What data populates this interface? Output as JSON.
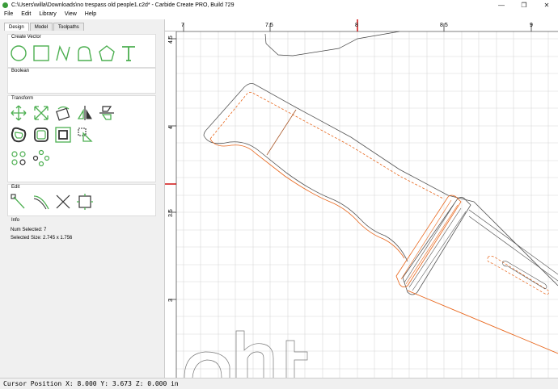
{
  "window": {
    "title": "C:\\Users\\willa\\Downloads\\no trespass old people1.c2d* - Carbide Create PRO, Build 729",
    "minimize": "—",
    "restore": "❐",
    "close": "✕"
  },
  "menu": [
    "File",
    "Edit",
    "Library",
    "View",
    "Help"
  ],
  "tabs": [
    "Design",
    "Model",
    "Toolpaths"
  ],
  "panel": {
    "create_vector": "Create Vector",
    "boolean": "Boolean",
    "transform": "Transform",
    "edit": "Edit",
    "info": "Info",
    "num_selected": "Num Selected:  7",
    "selected_size": "Selected Size:   2.745 x 1.756"
  },
  "ruler": {
    "x_labels": [
      "7",
      "7.5",
      "8",
      "8.5",
      "9"
    ],
    "y_labels": [
      "4.5",
      "4",
      "3.5",
      "3"
    ]
  },
  "status": {
    "cursor": "Cursor Position X: 8.000 Y: 3.673 Z: 0.000 in"
  },
  "colors": {
    "tool_green": "#4caf50",
    "selection_orange": "#e8651a",
    "cursor_red": "#cc0000",
    "grid": "#d8d8d8"
  },
  "icons": {
    "create_vector": [
      "circle-icon",
      "rectangle-icon",
      "polyline-icon",
      "curve-icon",
      "polygon-icon",
      "text-icon"
    ],
    "transform": [
      "move-icon",
      "scale-icon",
      "rotate-icon",
      "mirror-icon",
      "align-icon",
      "offset-icon",
      "fillet-icon",
      "inset-icon",
      "distort-icon",
      "array-icon",
      "circular-array-icon"
    ],
    "edit": [
      "node-edit-icon",
      "smooth-icon",
      "trim-icon",
      "join-icon"
    ]
  }
}
